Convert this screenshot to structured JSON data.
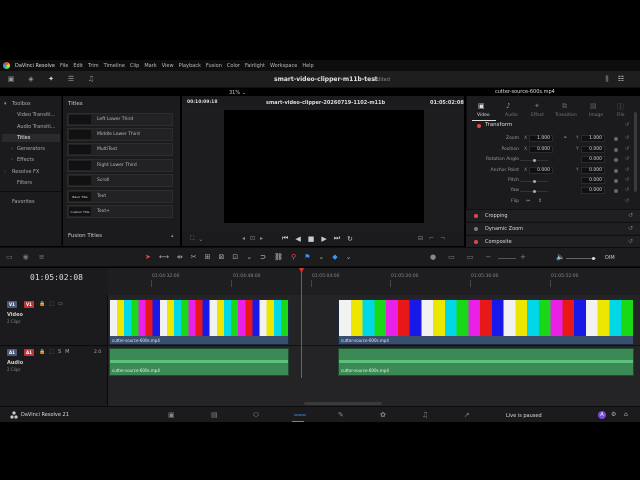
{
  "menu": {
    "items": [
      "DaVinci Resolve",
      "File",
      "Edit",
      "Trim",
      "Timeline",
      "Clip",
      "Mark",
      "View",
      "Playback",
      "Fusion",
      "Color",
      "Fairlight",
      "Workspace",
      "Help"
    ]
  },
  "toolbar": {
    "project_title": "smart-video-clipper-m11b-test",
    "project_status": "Edited",
    "clip_name": "cutter-source-600s.mp4"
  },
  "effects_tree": {
    "items": [
      "Toolbox",
      "Video Transiti...",
      "Audio Transiti...",
      "Titles",
      "Generators",
      "Effects",
      "Resolve FX",
      "Filters",
      "Favorites"
    ]
  },
  "titles_list": {
    "header": "Titles",
    "items": [
      "Left Lower Third",
      "Middle Lower Third",
      "MultiText",
      "Right Lower Third",
      "Scroll",
      "Text",
      "Text+"
    ],
    "thumbs": [
      "",
      "",
      "",
      "",
      "",
      "Basic Title",
      "Custom Title"
    ],
    "section2": "Fusion Titles"
  },
  "viewer": {
    "timecode_left": "00:10:09:18",
    "zoom": "31%",
    "timeline_name": "smart-video-clipper-20260719-1102-m11b",
    "timecode_right": "01:05:02:08"
  },
  "inspector": {
    "tabs": [
      "Video",
      "Audio",
      "Effect",
      "Transition",
      "Image",
      "File"
    ],
    "section_transform": "Transform",
    "props": [
      {
        "label": "Zoom",
        "x": "1.000",
        "y": "1.000"
      },
      {
        "label": "Position",
        "x": "0.000",
        "y": "0.000"
      },
      {
        "label": "Rotation Angle",
        "v": "0.000"
      },
      {
        "label": "Anchor Point",
        "x": "0.000",
        "y": "0.000"
      },
      {
        "label": "Pitch",
        "v": "0.000"
      },
      {
        "label": "Yaw",
        "v": "0.000"
      },
      {
        "label": "Flip",
        "v": ""
      }
    ],
    "axis_x": "X",
    "axis_y": "Y",
    "sections": [
      "Cropping",
      "Dynamic Zoom",
      "Composite"
    ]
  },
  "timeline": {
    "timecode": "01:05:02:08",
    "ruler": [
      "01:04:32:00",
      "01:04:48:00",
      "01:05:04:00",
      "01:05:20:00",
      "01:05:36:00",
      "01:05:52:00"
    ],
    "volume_label": "DIM",
    "tracks": [
      {
        "badge": "V1",
        "name": "Video",
        "clips": "2 Clips"
      },
      {
        "badge": "A1",
        "name": "Audio",
        "clips": "2 Clips",
        "level": "2.0"
      }
    ],
    "clip_label": "cutter-source-600s.mp4"
  },
  "footer": {
    "app_name": "DaVinci Resolve 21",
    "live_status": "Live is paused",
    "user_initial": "A"
  },
  "colors": {
    "accent_red": "#e24848",
    "video_clip": "#3a4e6e",
    "audio_clip": "#3b8a55",
    "playhead": "#e03030"
  }
}
